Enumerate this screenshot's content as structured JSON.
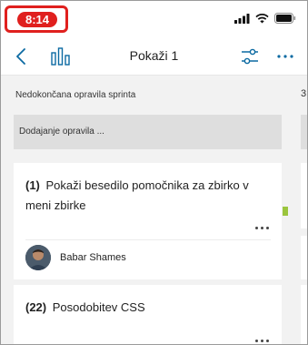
{
  "status_bar": {
    "time": "8:14",
    "time_highlight_color": "#e0201e"
  },
  "nav": {
    "title": "Pokaži 1",
    "back_icon": "chevron-left-icon",
    "chart_icon": "bar-chart-icon",
    "filter_icon": "sliders-icon",
    "more_icon": "more-horizontal-icon"
  },
  "board": {
    "column": {
      "title": "Nedokončana opravila sprinta",
      "add_task_label": "Dodajanje opravila ..."
    },
    "next_column_title_fragment": "3",
    "cards": [
      {
        "number": "(1)",
        "title": "Pokaži besedilo pomočnika za zbirko v meni zbirke",
        "assignee": "Babar Shames"
      },
      {
        "number": "(22)",
        "title": "Posodobitev CSS"
      }
    ]
  },
  "colors": {
    "accent": "#0b6aa2",
    "label_green": "#9bc53d"
  }
}
